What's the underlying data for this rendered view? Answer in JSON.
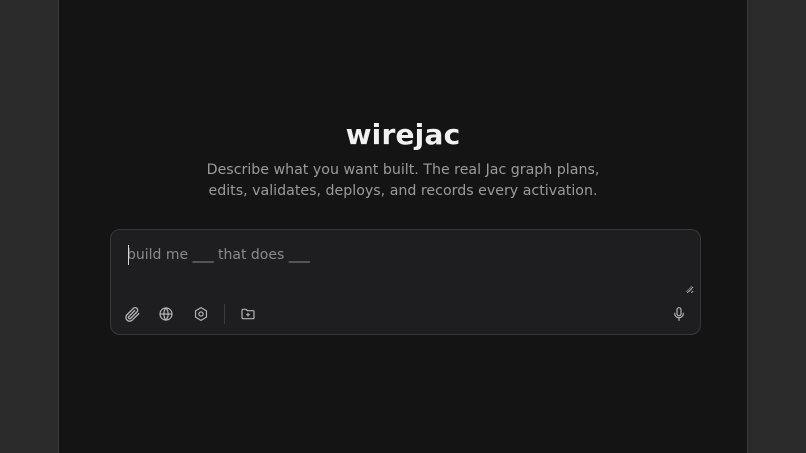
{
  "app": {
    "title": "wirejac",
    "subtitle_line1": "Describe what you want built. The real Jac graph plans,",
    "subtitle_line2": "edits, validates, deploys, and records every activation."
  },
  "composer": {
    "placeholder": "build me ___ that does ___",
    "value": "",
    "tools": [
      {
        "name": "attach",
        "icon": "paperclip-icon"
      },
      {
        "name": "web",
        "icon": "globe-icon"
      },
      {
        "name": "settings",
        "icon": "gear-icon"
      },
      {
        "name": "folder",
        "icon": "folder-icon"
      }
    ],
    "voice_icon": "microphone-icon"
  },
  "colors": {
    "background": "#2a2a2b",
    "panel": "#141415",
    "composer": "#1e1e20",
    "title": "#f2f2f2",
    "subtitle": "#9b9b9e"
  }
}
